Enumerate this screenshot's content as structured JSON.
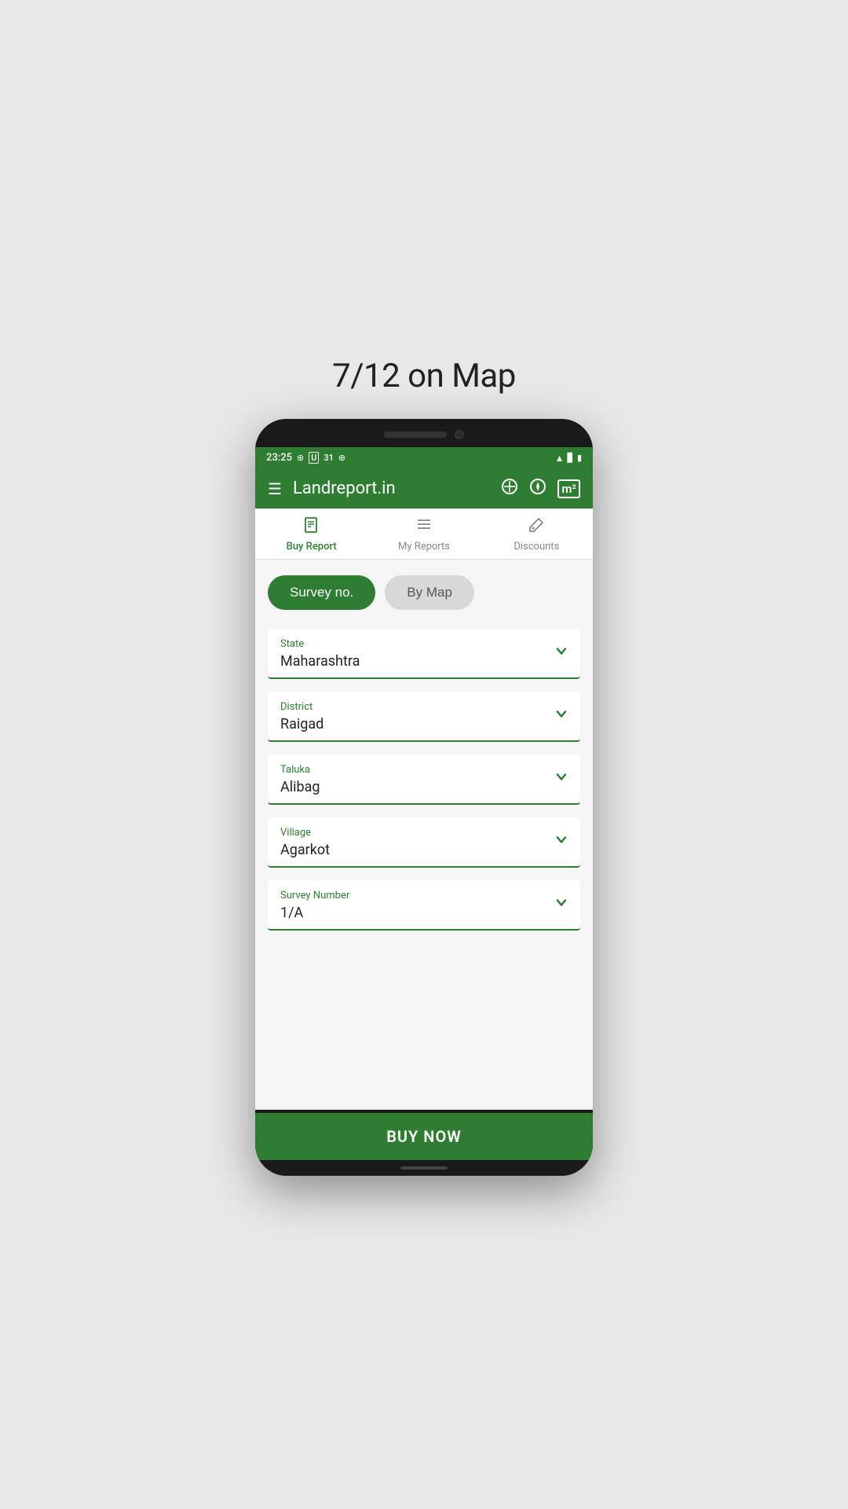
{
  "page": {
    "title": "7/12 on Map"
  },
  "status_bar": {
    "time": "23:25",
    "icons_left": [
      "notification-icon",
      "u-icon",
      "calendar-icon",
      "w-icon"
    ],
    "icons_right": [
      "wifi-icon",
      "signal-icon",
      "battery-icon"
    ]
  },
  "header": {
    "menu_icon": "≡",
    "title": "Landreport.in",
    "icons": [
      "measure-icon",
      "compass-icon",
      "map-icon"
    ]
  },
  "tabs": [
    {
      "id": "buy-report",
      "label": "Buy Report",
      "active": true
    },
    {
      "id": "my-reports",
      "label": "My Reports",
      "active": false
    },
    {
      "id": "discounts",
      "label": "Discounts",
      "active": false
    }
  ],
  "toggle": {
    "survey_no": "Survey no.",
    "by_map": "By Map",
    "active": "survey_no"
  },
  "fields": [
    {
      "id": "state",
      "label": "State",
      "value": "Maharashtra"
    },
    {
      "id": "district",
      "label": "District",
      "value": "Raigad"
    },
    {
      "id": "taluka",
      "label": "Taluka",
      "value": "Alibag"
    },
    {
      "id": "village",
      "label": "Village",
      "value": "Agarkot"
    },
    {
      "id": "survey-number",
      "label": "Survey Number",
      "value": "1/A"
    }
  ],
  "buy_button": {
    "label": "BUY NOW"
  },
  "icons": {
    "hamburger": "☰",
    "chevron_down": "✓",
    "buy_report_icon": "📄",
    "my_reports_icon": "☰",
    "discounts_icon": "🛒",
    "header_icon1": "⊙",
    "header_icon2": "◎",
    "header_icon3": "m²"
  }
}
